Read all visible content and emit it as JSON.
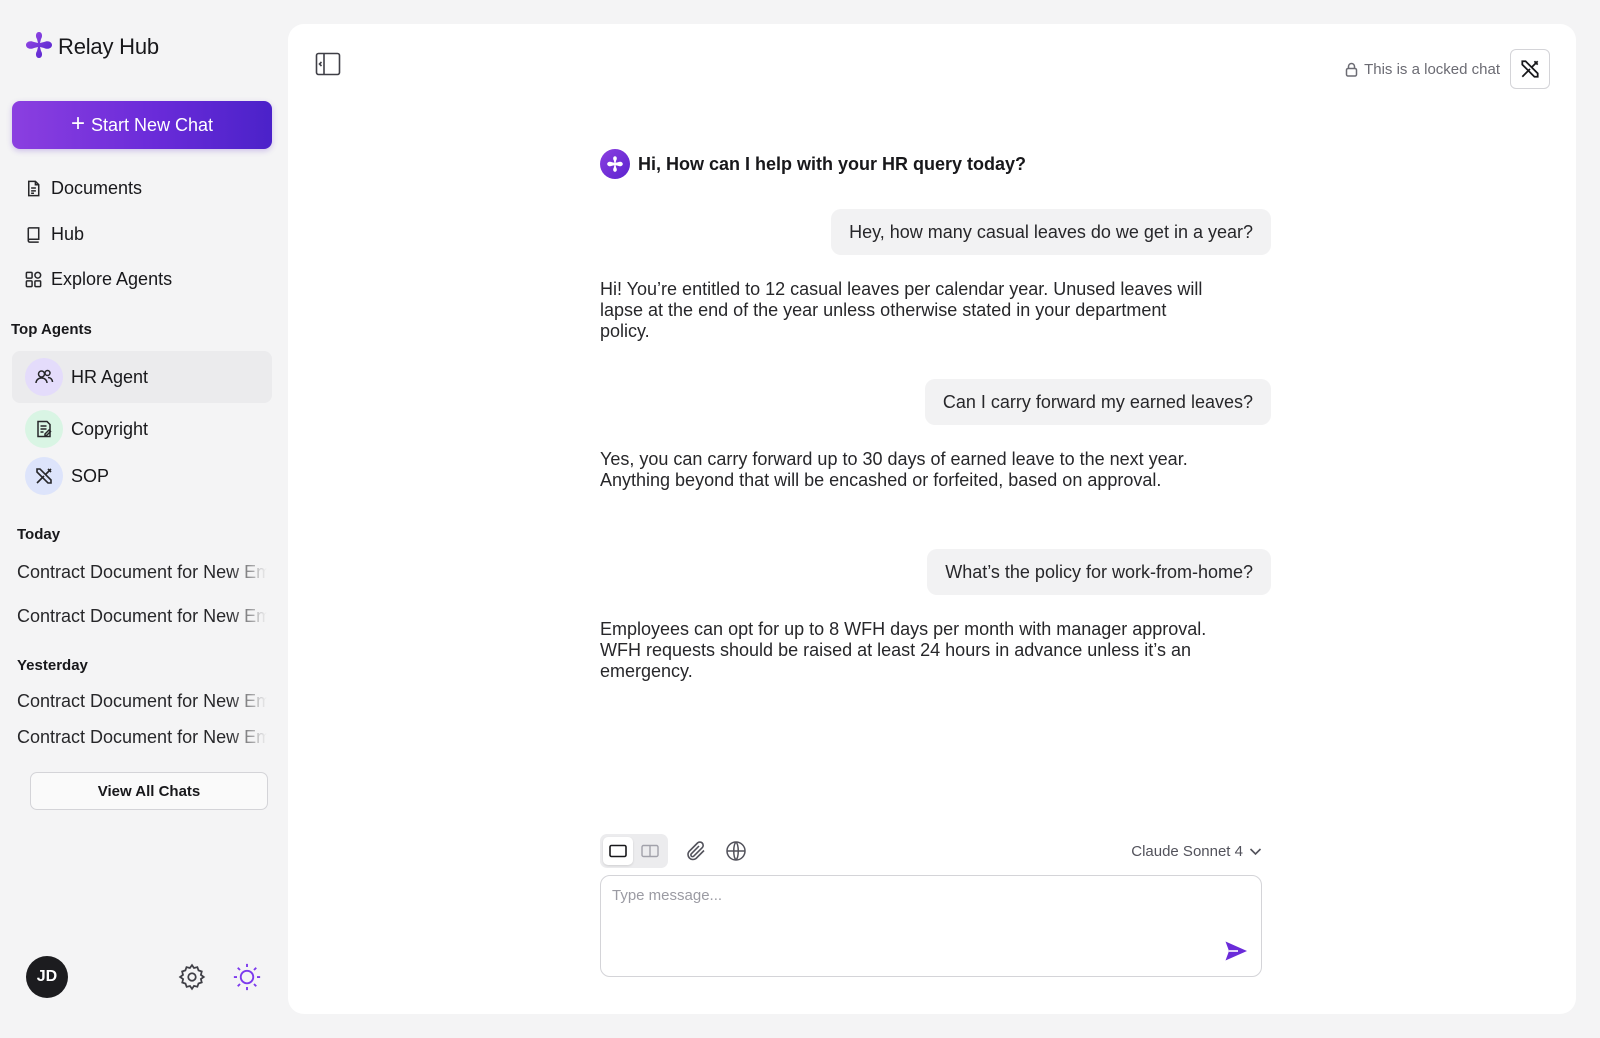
{
  "app": {
    "name": "Relay Hub"
  },
  "sidebar": {
    "new_chat_label": "Start New Chat",
    "nav": [
      {
        "label": "Documents",
        "icon": "document-icon"
      },
      {
        "label": "Hub",
        "icon": "book-icon"
      },
      {
        "label": "Explore Agents",
        "icon": "grid-icon"
      }
    ],
    "top_agents_title": "Top Agents",
    "agents": [
      {
        "label": "HR Agent",
        "icon": "users-icon",
        "color": "#e4dcfb",
        "active": true
      },
      {
        "label": "Copyright",
        "icon": "note-icon",
        "color": "#d9f5e4",
        "active": false
      },
      {
        "label": "SOP",
        "icon": "tools-icon",
        "color": "#dde4fb",
        "active": false
      }
    ],
    "history": {
      "today_label": "Today",
      "today": [
        "Contract Document for New Employee",
        "Contract Document for New Employee"
      ],
      "yesterday_label": "Yesterday",
      "yesterday": [
        "Contract Document for New Employee",
        "Contract Document for New Employee"
      ]
    },
    "view_all_label": "View All Chats",
    "user_initials": "JD"
  },
  "header": {
    "locked_text": "This is a locked chat"
  },
  "chat": {
    "greeting": "Hi, How can I help with your HR query today?",
    "messages": [
      {
        "role": "user",
        "text": "Hey, how many casual leaves do we get in a year?"
      },
      {
        "role": "assistant",
        "text": "Hi! You’re entitled to 12 casual leaves per calendar year. Unused leaves will lapse at the end of the year unless otherwise stated in your department policy."
      },
      {
        "role": "user",
        "text": "Can I carry forward my earned leaves?"
      },
      {
        "role": "assistant",
        "text": "Yes, you can carry forward up to 30 days of earned leave to the next year. Anything beyond that will be encashed or forfeited, based on approval."
      },
      {
        "role": "user",
        "text": "What’s the policy for work-from-home?"
      },
      {
        "role": "assistant",
        "text": "Employees can opt for up to 8 WFH days per month with manager approval. WFH requests should be raised at least 24 hours in advance unless it’s an emergency."
      }
    ]
  },
  "composer": {
    "placeholder": "Type message...",
    "model": "Claude Sonnet 4"
  },
  "colors": {
    "accent": "#6a2bd9",
    "accent_dark": "#4b22c9",
    "background": "#f4f4f5",
    "panel": "#ffffff",
    "bubble": "#f2f2f3"
  }
}
